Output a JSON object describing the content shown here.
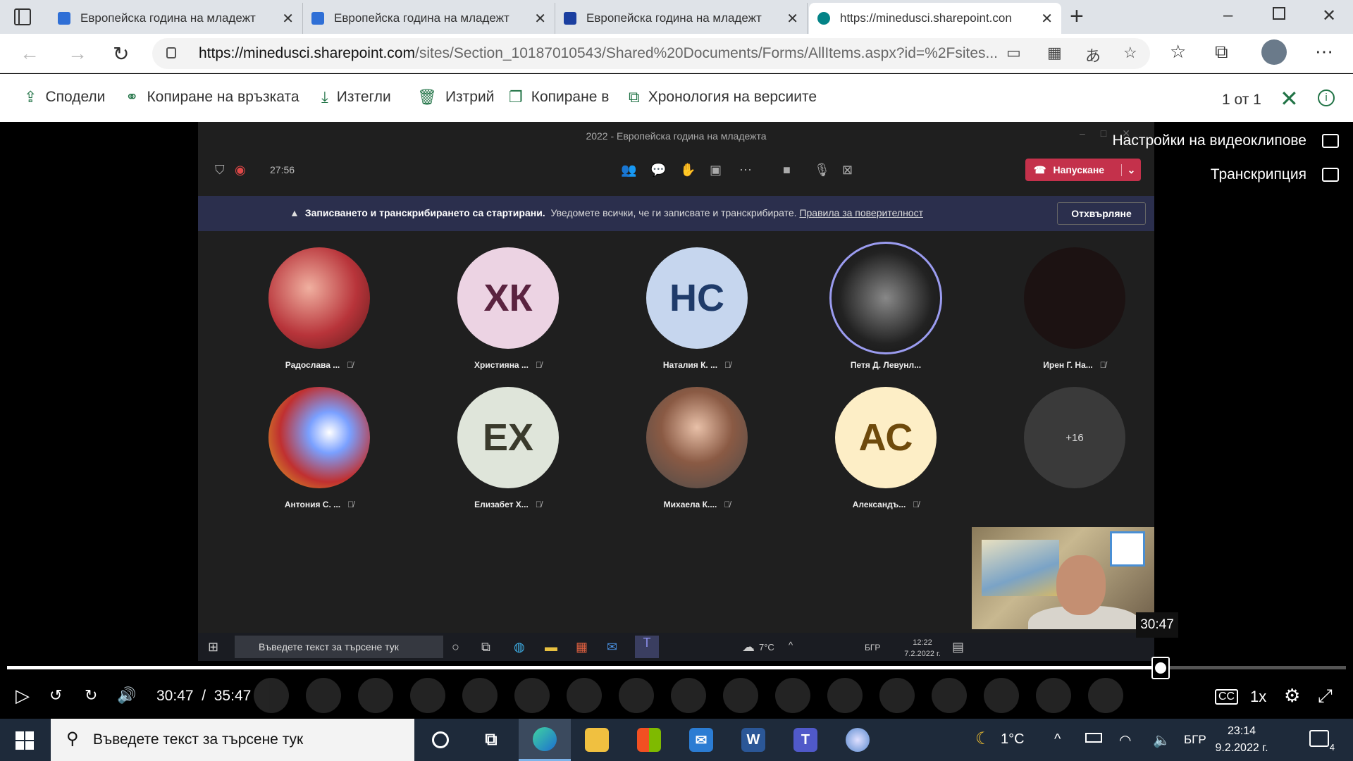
{
  "browser": {
    "tabs": [
      {
        "title": "Европейска година на младежт",
        "favicon": "bing-icon",
        "color": "#2f6fd6"
      },
      {
        "title": "Европейска година на младежт",
        "favicon": "bing-icon",
        "color": "#2f6fd6"
      },
      {
        "title": "Европейска година на младежт",
        "favicon": "eu-flag-icon",
        "color": "#1b3fa0"
      },
      {
        "title": "https://minedusci.sharepoint.con",
        "favicon": "sharepoint-icon",
        "color": "#038387"
      }
    ],
    "url_host": "https://minedusci.sharepoint.com",
    "url_path": "/sites/Section_10187010543/Shared%20Documents/Forms/AllItems.aspx?id=%2Fsites..."
  },
  "commands": {
    "share": "Сподели",
    "copy_link": "Копиране на връзката",
    "download": "Изтегли",
    "delete": "Изтрий",
    "copy_to": "Копиране в",
    "version_history": "Хронология на версиите",
    "pager": "1 от 1"
  },
  "recording": {
    "window_title": "2022 - Европейска година на младежта",
    "elapsed": "27:56",
    "hangup_label": "Напускане",
    "banner_bold": "Записването и транскрибирането са стартирани.",
    "banner_text": "Уведомете всички, че ги записвате и транскрибирате.",
    "banner_link": "Правила за поверителност",
    "dismiss_label": "Отхвърляне",
    "participants": [
      {
        "name": "Радослава ...",
        "initials": "",
        "bg": "#b8343a"
      },
      {
        "name": "Християна ...",
        "initials": "ХК",
        "bg": "#ecd3e3",
        "fg": "#5a2340"
      },
      {
        "name": "Наталия К. ...",
        "initials": "НС",
        "bg": "#c6d6ee",
        "fg": "#1f3b6a"
      },
      {
        "name": "Петя Д. Левунл...",
        "initials": "",
        "bg": "#2a2a2a"
      },
      {
        "name": "Ирен Г. На...",
        "initials": "",
        "bg": "#1c1212"
      },
      {
        "name": "Антония С. ...",
        "initials": "",
        "bg": "#6f7fd0"
      },
      {
        "name": "Елизабет Х...",
        "initials": "ЕХ",
        "bg": "#dfe5da",
        "fg": "#3a3a2c"
      },
      {
        "name": "Михаела К....",
        "initials": "",
        "bg": "#9c7a6a"
      },
      {
        "name": "Александъ...",
        "initials": "АС",
        "bg": "#fdeec6",
        "fg": "#6e4a0c"
      },
      {
        "name": "",
        "initials": "+16",
        "bg": "#3a3a3a",
        "fg": "#ddd"
      }
    ],
    "taskbar_search": "Въведете текст за търсене тук",
    "weather": "7°C",
    "lang": "БГР",
    "time": "12:22",
    "date": "7.2.2022 г."
  },
  "video": {
    "side_captions": "Настройки на видеоклипове",
    "side_transcript": "Транскрипция",
    "tooltip_time": "30:47",
    "current_time": "30:47",
    "separator": "/",
    "total_time": "35:47",
    "progress": 0.8615,
    "speed": "1x"
  },
  "taskbar": {
    "search_placeholder": "Въведете текст за търсене тук",
    "temperature": "1°C",
    "language": "БГР",
    "time": "23:14",
    "date": "9.2.2022 г.",
    "notifications": "4"
  }
}
